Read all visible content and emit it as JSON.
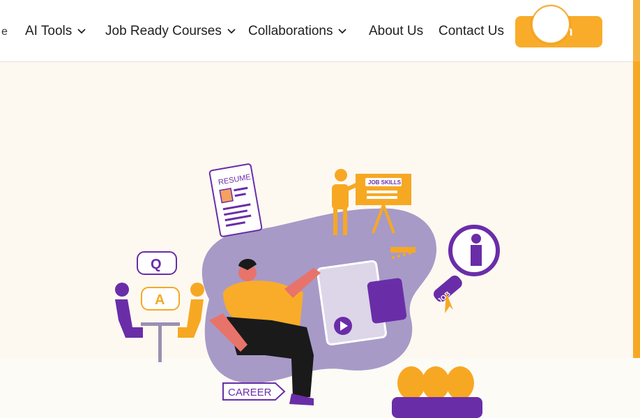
{
  "nav": {
    "cut_item": "e",
    "items": [
      {
        "label": "AI Tools"
      },
      {
        "label": "Job Ready Courses"
      },
      {
        "label": "Collaborations"
      },
      {
        "label": "About Us"
      },
      {
        "label": "Contact Us"
      }
    ],
    "cta_label": "n"
  },
  "hero": {
    "resume_label": "RESUME",
    "job_skills_label": "JOB SKILLS",
    "q_label": "Q",
    "a_label": "A",
    "job_label": "JOB",
    "career_label": "CAREER"
  },
  "colors": {
    "accent": "#f9ac2a",
    "purple": "#6a2da8",
    "lavender": "#a79ac7"
  }
}
